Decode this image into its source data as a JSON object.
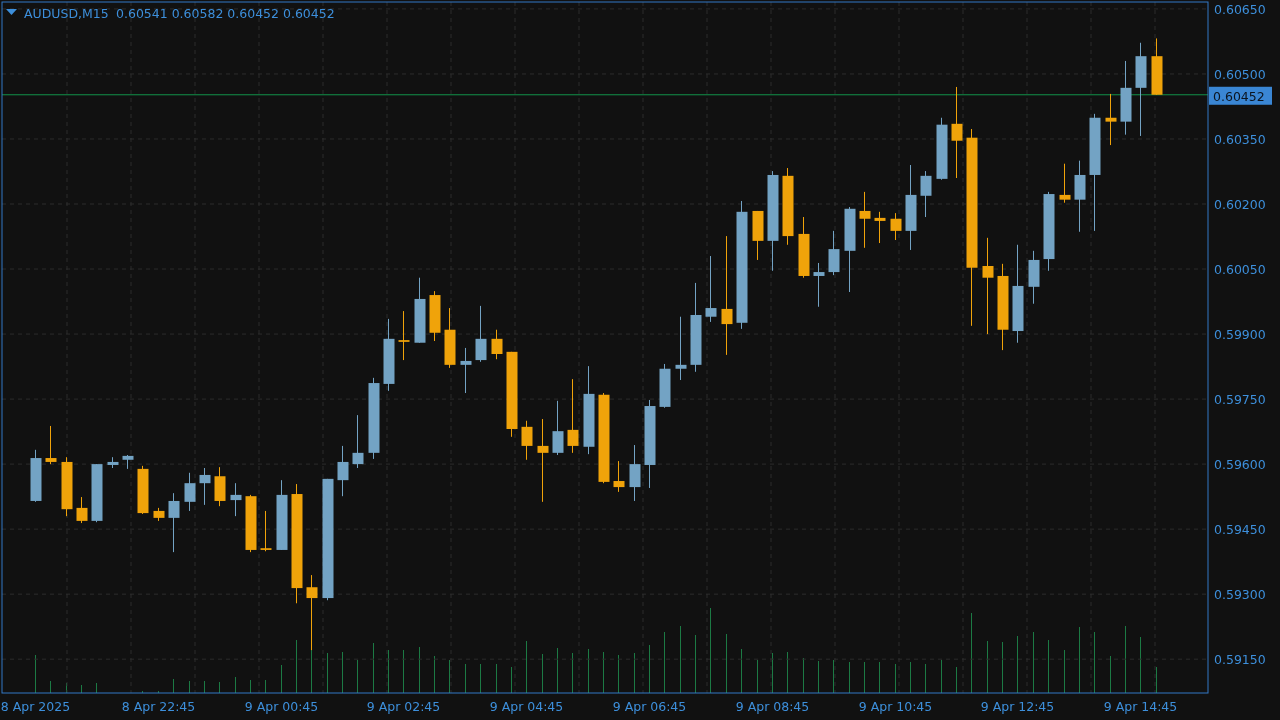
{
  "chart": {
    "symbol": "AUDUSD,M15",
    "ohlc_readout": "0.60541 0.60582 0.60452 0.60452",
    "chart_data": {
      "type": "candlestick",
      "ylim": [
        0.59072,
        0.60666
      ],
      "grid": true,
      "yticks": [
        {
          "value": 0.5915,
          "label": "0.59150"
        },
        {
          "value": 0.593,
          "label": "0.59300"
        },
        {
          "value": 0.5945,
          "label": "0.59450"
        },
        {
          "value": 0.596,
          "label": "0.59600"
        },
        {
          "value": 0.5975,
          "label": "0.59750"
        },
        {
          "value": 0.599,
          "label": "0.59900"
        },
        {
          "value": 0.6005,
          "label": "0.60050"
        },
        {
          "value": 0.602,
          "label": "0.60200"
        },
        {
          "value": 0.6035,
          "label": "0.60350"
        },
        {
          "value": 0.605,
          "label": "0.60500"
        },
        {
          "value": 0.6065,
          "label": "0.60650"
        }
      ],
      "categories": [
        "8 Apr 2025",
        null,
        null,
        null,
        null,
        null,
        null,
        null,
        "8 Apr 22:45",
        null,
        null,
        null,
        null,
        null,
        null,
        null,
        "9 Apr 00:45",
        null,
        null,
        null,
        null,
        null,
        null,
        null,
        "9 Apr 02:45",
        null,
        null,
        null,
        null,
        null,
        null,
        null,
        "9 Apr 04:45",
        null,
        null,
        null,
        null,
        null,
        null,
        null,
        "9 Apr 06:45",
        null,
        null,
        null,
        null,
        null,
        null,
        null,
        "9 Apr 08:45",
        null,
        null,
        null,
        null,
        null,
        null,
        null,
        "9 Apr 10:45",
        null,
        null,
        null,
        null,
        null,
        null,
        null,
        "9 Apr 12:45",
        null,
        null,
        null,
        null,
        null,
        null,
        null,
        "9 Apr 14:45",
        null
      ],
      "ohlc": [
        [
          0.59515,
          0.59633,
          0.59513,
          0.59614
        ],
        [
          0.59614,
          0.59688,
          0.596,
          0.59605
        ],
        [
          0.59605,
          0.59616,
          0.5948,
          0.59496
        ],
        [
          0.59499,
          0.59524,
          0.59464,
          0.59469
        ],
        [
          0.59469,
          0.596,
          0.59466,
          0.596
        ],
        [
          0.59598,
          0.59616,
          0.59591,
          0.59605
        ],
        [
          0.5961,
          0.59621,
          0.59589,
          0.59619
        ],
        [
          0.59589,
          0.59596,
          0.59485,
          0.59487
        ],
        [
          0.59492,
          0.59499,
          0.59469,
          0.59476
        ],
        [
          0.59476,
          0.59533,
          0.59397,
          0.59515
        ],
        [
          0.59513,
          0.5958,
          0.59492,
          0.59556
        ],
        [
          0.59556,
          0.59591,
          0.59506,
          0.59575
        ],
        [
          0.59572,
          0.59593,
          0.59503,
          0.59515
        ],
        [
          0.59517,
          0.59556,
          0.5948,
          0.59529
        ],
        [
          0.59526,
          0.59529,
          0.59397,
          0.59402
        ],
        [
          0.59406,
          0.59492,
          0.59399,
          0.59402
        ],
        [
          0.59402,
          0.59563,
          0.59402,
          0.59529
        ],
        [
          0.59531,
          0.59554,
          0.59279,
          0.59314
        ],
        [
          0.59316,
          0.59344,
          0.59171,
          0.59291
        ],
        [
          0.59291,
          0.59566,
          0.59286,
          0.59566
        ],
        [
          0.59563,
          0.59642,
          0.59526,
          0.59605
        ],
        [
          0.596,
          0.59713,
          0.59591,
          0.59626
        ],
        [
          0.59626,
          0.59799,
          0.59612,
          0.59787
        ],
        [
          0.59785,
          0.59935,
          0.59769,
          0.59889
        ],
        [
          0.59886,
          0.59953,
          0.5984,
          0.59882
        ],
        [
          0.5988,
          0.6003,
          0.5988,
          0.59981
        ],
        [
          0.5999,
          0.59999,
          0.59884,
          0.59903
        ],
        [
          0.5991,
          0.5996,
          0.59822,
          0.59829
        ],
        [
          0.59829,
          0.59868,
          0.59764,
          0.59838
        ],
        [
          0.5984,
          0.59965,
          0.59836,
          0.59889
        ],
        [
          0.59889,
          0.5991,
          0.59842,
          0.59854
        ],
        [
          0.59859,
          0.59859,
          0.59663,
          0.59681
        ],
        [
          0.59686,
          0.597,
          0.5961,
          0.59642
        ],
        [
          0.59642,
          0.59704,
          0.59513,
          0.59626
        ],
        [
          0.59626,
          0.59746,
          0.59621,
          0.59676
        ],
        [
          0.59679,
          0.59796,
          0.59626,
          0.59642
        ],
        [
          0.5964,
          0.59826,
          0.59623,
          0.59762
        ],
        [
          0.5976,
          0.59764,
          0.59556,
          0.59559
        ],
        [
          0.59561,
          0.59607,
          0.59536,
          0.59547
        ],
        [
          0.59547,
          0.59644,
          0.59515,
          0.596
        ],
        [
          0.59598,
          0.59748,
          0.59545,
          0.59734
        ],
        [
          0.59732,
          0.59831,
          0.5973,
          0.5982
        ],
        [
          0.5982,
          0.5994,
          0.59794,
          0.59829
        ],
        [
          0.59829,
          0.60018,
          0.59813,
          0.59944
        ],
        [
          0.5994,
          0.6008,
          0.59928,
          0.5996
        ],
        [
          0.59958,
          0.60126,
          0.59852,
          0.59923
        ],
        [
          0.59926,
          0.60207,
          0.59912,
          0.60182
        ],
        [
          0.60184,
          0.60184,
          0.60071,
          0.60115
        ],
        [
          0.60115,
          0.60276,
          0.60046,
          0.60267
        ],
        [
          0.60265,
          0.60283,
          0.60106,
          0.60126
        ],
        [
          0.60131,
          0.6017,
          0.6003,
          0.60034
        ],
        [
          0.60034,
          0.60064,
          0.59963,
          0.60043
        ],
        [
          0.60043,
          0.60138,
          0.60036,
          0.60096
        ],
        [
          0.60092,
          0.60193,
          0.59997,
          0.60189
        ],
        [
          0.60184,
          0.60228,
          0.60099,
          0.60166
        ],
        [
          0.60168,
          0.60182,
          0.6011,
          0.60161
        ],
        [
          0.60166,
          0.60179,
          0.60117,
          0.60138
        ],
        [
          0.60138,
          0.6029,
          0.60094,
          0.60221
        ],
        [
          0.60219,
          0.60276,
          0.6017,
          0.60265
        ],
        [
          0.60258,
          0.60399,
          0.60256,
          0.60383
        ],
        [
          0.60385,
          0.6047,
          0.6026,
          0.60346
        ],
        [
          0.60353,
          0.60373,
          0.59919,
          0.60053
        ],
        [
          0.60057,
          0.60122,
          0.599,
          0.6003
        ],
        [
          0.60034,
          0.60062,
          0.59863,
          0.5991
        ],
        [
          0.59907,
          0.60106,
          0.5988,
          0.60011
        ],
        [
          0.60009,
          0.60092,
          0.5997,
          0.60071
        ],
        [
          0.60073,
          0.60228,
          0.60046,
          0.60223
        ],
        [
          0.60221,
          0.60293,
          0.60203,
          0.6021
        ],
        [
          0.6021,
          0.603,
          0.60136,
          0.60267
        ],
        [
          0.60267,
          0.60408,
          0.60138,
          0.60399
        ],
        [
          0.60399,
          0.60454,
          0.60336,
          0.6039
        ],
        [
          0.6039,
          0.6053,
          0.6036,
          0.60468
        ],
        [
          0.60468,
          0.60572,
          0.60357,
          0.60541
        ],
        [
          0.60541,
          0.60582,
          0.60452,
          0.60452
        ]
      ],
      "ref_lines": [
        {
          "axis": "y",
          "value": 0.60452,
          "label": "0.60452"
        }
      ]
    }
  }
}
